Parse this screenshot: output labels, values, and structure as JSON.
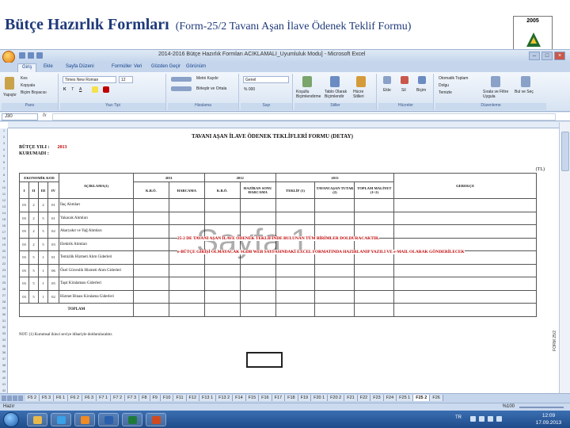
{
  "slide": {
    "title": "Bütçe Hazırlık Formları",
    "subtitle": "(Form-25/2 Tavanı Aşan İlave Ödenek Teklif Formu)",
    "logo_year": "2005"
  },
  "excel": {
    "window_title": "2014-2016 Bütçe Hazırlık Formları ACIKLAMALI_Uyumluluk Modu] - Microsoft Excel",
    "tabs": [
      "Giriş",
      "Ekle",
      "Sayfa Düzeni",
      "Formüller",
      "Veri",
      "Gözden Geçir",
      "Görünüm"
    ],
    "ribbon": {
      "paste": "Yapıştır",
      "cut": "Kes",
      "copy": "Kopyala",
      "format_painter": "Biçim Boyacısı",
      "clipboard_group": "Pano",
      "font_name": "Times New Roman",
      "font_size": "12",
      "font_group": "Yazı Tipi",
      "wrap_text": "Metni Kaydır",
      "merge_center": "Birleştir ve Ortala",
      "alignment_group": "Hizalama",
      "number_format": "Genel",
      "number_group": "Sayı",
      "conditional_format": "Koşullu Biçimlendirme",
      "format_as_table": "Tablo Olarak Biçimlendir",
      "cell_styles": "Hücre Stilleri",
      "styles_group": "Stiller",
      "insert": "Ekle",
      "delete": "Sil",
      "format": "Biçim",
      "cells_group": "Hücreler",
      "autosum": "Otomatik Toplam",
      "fill": "Dolgu",
      "clear": "Temizle",
      "sort_filter": "Sırala ve Filtre Uygula",
      "find_select": "Bul ve Seç",
      "editing_group": "Düzenleme"
    },
    "name_box": "J30",
    "status": {
      "ready": "Hazır",
      "zoom": "%100"
    },
    "sheet_tabs": [
      "F5 2",
      "F5 3",
      "F6 1",
      "F6 2",
      "F6 3",
      "F7 1",
      "F7 2",
      "F7 3",
      "F8",
      "F9",
      "F10",
      "F11",
      "F12",
      "F13 1",
      "F13 2",
      "F14",
      "F15",
      "F16",
      "F17",
      "F18",
      "F19",
      "F20 1",
      "F20 2",
      "F21",
      "F22",
      "F23",
      "F24",
      "F25 1",
      "F25 2",
      "F26"
    ],
    "active_sheet_tab": "F25 2",
    "clock_time": "12:09",
    "clock_date": "17.09.2013",
    "lang": "TR"
  },
  "form": {
    "title": "TAVANI AŞAN İLAVE ÖDENEK TEKLİFLERİ FORMU (DETAY)",
    "budget_year_label": "BÜTÇE YILI :",
    "budget_year_value": "2013",
    "institution_label": "KURUMADI :",
    "unit_label": "(TL)",
    "headers": {
      "economic_code": "EKONOMİK KOD",
      "levels": [
        "I",
        "II",
        "III",
        "IV"
      ],
      "description": "AÇIKLAMA(1)",
      "year1": "2011",
      "year2": "2012",
      "year3": "2013",
      "justification": "GEREKÇE",
      "kbo": "K.B.Ö.",
      "spending": "HARCAMA",
      "june_spending": "HAZİRAN SONU HARCAMA",
      "proposal": "TEKLİF (1)",
      "exceeding_amount": "TAVANI AŞAN TUTAR (2)",
      "total_cost": "TOPLAM MALİYET (1+2)"
    },
    "rows": [
      {
        "c1": "03",
        "c2": "2",
        "c3": "2",
        "c4": "01",
        "desc": "İlaç Alımları"
      },
      {
        "c1": "03",
        "c2": "2",
        "c3": "5",
        "c4": "01",
        "desc": "Yakacak Alımları"
      },
      {
        "c1": "03",
        "c2": "2",
        "c3": "5",
        "c4": "02",
        "desc": "Akaryakıt ve Yağ Alımları"
      },
      {
        "c1": "03",
        "c2": "2",
        "c3": "5",
        "c4": "03",
        "desc": "Elektrik Alımları"
      },
      {
        "c1": "03",
        "c2": "5",
        "c3": "1",
        "c4": "01",
        "desc": "Temizlik Hizmeti Alım Giderleri"
      },
      {
        "c1": "03",
        "c2": "5",
        "c3": "1",
        "c4": "06",
        "desc": "Özel Güvenlik Hizmeti Alım Giderleri"
      },
      {
        "c1": "03",
        "c2": "5",
        "c3": "1",
        "c4": "05",
        "desc": "Taşıt Kiralaması Giderleri"
      },
      {
        "c1": "03",
        "c2": "5",
        "c3": "1",
        "c4": "02",
        "desc": "Hizmet Binası Kiralama Giderleri"
      }
    ],
    "total_label": "TOPLAM",
    "red_note_1": "25-2 DE TAVANI AŞAN İLAVE ÖDENEK TEKLİFİNDE BULUNAN TÜM BİRİMLER DOLDURACAKTIR.",
    "red_note_2": "e-BÜTÇE GİRİŞİ OLMAYACAK SGDB WEB SAYFASINDAKİ EXCEL FORMATINDA HAZIRLANIP YAZILI VE e-MAIL OLARAK GÖNDERİLECEK",
    "footnote": "NOT: (1) Kurumsal ikinci seviye itibariyle doldurulacaktır.",
    "side_code": "FORM 25/2",
    "watermark": "Sayfa 1"
  }
}
